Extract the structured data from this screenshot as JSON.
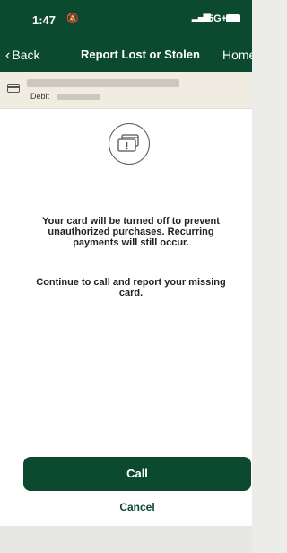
{
  "status_bar": {
    "time": "1:47",
    "network": "5G+"
  },
  "nav": {
    "back_label": "Back",
    "title": "Report Lost or Stolen",
    "home_label": "Home"
  },
  "account": {
    "type_label": "Debit"
  },
  "message": {
    "main": "Your card will be turned off to prevent unauthorized purchases. Recurring payments will still occur.",
    "secondary": "Continue to call and report your missing card."
  },
  "actions": {
    "call_label": "Call",
    "cancel_label": "Cancel"
  },
  "colors": {
    "brand_green": "#0c4a2f",
    "account_bar": "#f1ece1"
  }
}
